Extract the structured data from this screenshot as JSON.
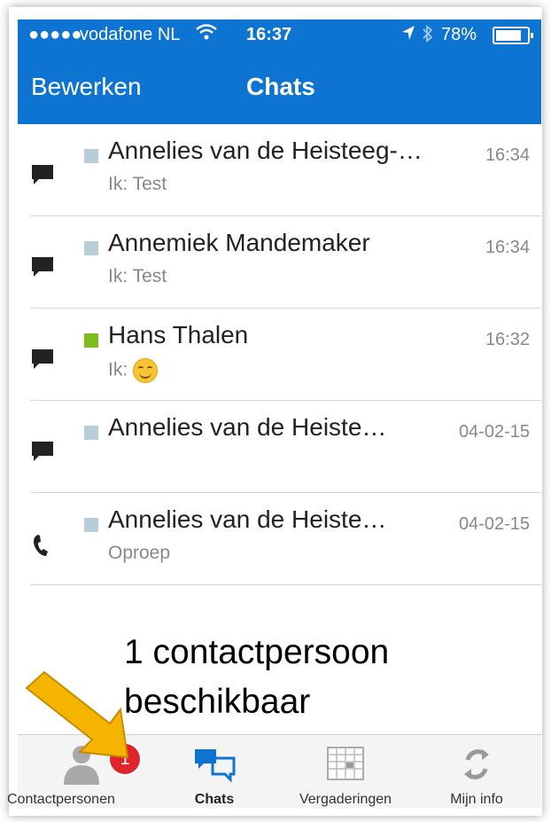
{
  "status_bar": {
    "signal": "●●●●●",
    "carrier": "vodafone NL",
    "wifi_icon": "wifi-icon",
    "time": "16:37",
    "location_icon": "location-arrow-icon",
    "bluetooth_icon": "bluetooth-icon",
    "battery": "78%"
  },
  "nav": {
    "edit_label": "Bewerken",
    "title": "Chats"
  },
  "chats": [
    {
      "name": "Annelies van de Heisteeg-…",
      "sub": "Ik: Test",
      "time": "16:34",
      "icon": "chat-icon",
      "presence": "away"
    },
    {
      "name": "Annemiek Mandemaker",
      "sub": "Ik: Test",
      "time": "16:34",
      "icon": "chat-icon",
      "presence": "away"
    },
    {
      "name": "Hans Thalen",
      "sub": "Ik:",
      "time": "16:32",
      "icon": "chat-icon",
      "presence": "online"
    },
    {
      "name": "Annelies van de Heiste…",
      "sub": "",
      "time": "04-02-15",
      "icon": "chat-icon",
      "presence": "away"
    },
    {
      "name": "Annelies van de Heiste…",
      "sub": "Oproep",
      "time": "04-02-15",
      "icon": "phone-icon",
      "presence": "away"
    }
  ],
  "annotation": {
    "line1": "1 contactpersoon",
    "line2": "beschikbaar"
  },
  "tabs": [
    {
      "label": "Contactpersonen",
      "icon": "person-icon",
      "badge": "1"
    },
    {
      "label": "Chats",
      "icon": "chats-icon"
    },
    {
      "label": "Vergaderingen",
      "icon": "calendar-icon"
    },
    {
      "label": "Mijn info",
      "icon": "sync-icon"
    }
  ],
  "colors": {
    "header": "#0d74d2",
    "online": "#7cbd1e",
    "away": "#b7cdd8",
    "badge": "#e0242b",
    "arrow": "#f4b400"
  }
}
